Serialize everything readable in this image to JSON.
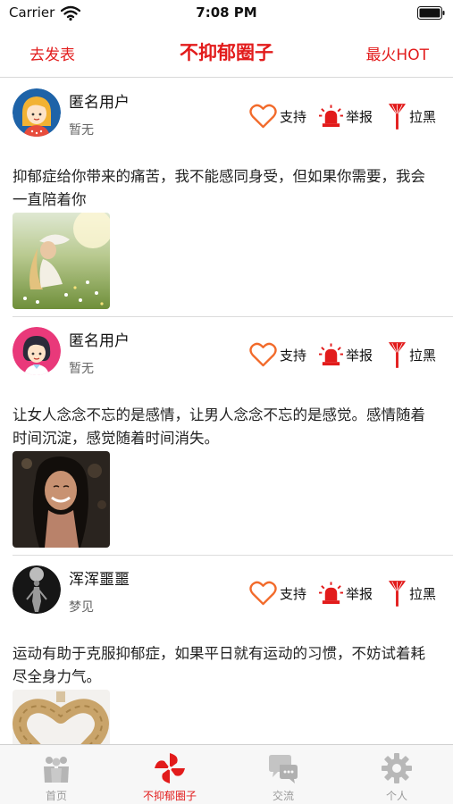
{
  "status_bar": {
    "carrier": "Carrier",
    "time": "7:08 PM"
  },
  "nav": {
    "left_label": "去发表",
    "title": "不抑郁圈子",
    "right_label": "最火HOT"
  },
  "posts": [
    {
      "username": "匿名用户",
      "subtitle": "暂无",
      "content": "抑郁症给你带来的痛苦，我不能感同身受，但如果你需要，我会一直陪着你",
      "avatar_icon": "blonde-girl-avatar-icon",
      "image": "girl-in-meadow-photo"
    },
    {
      "username": "匿名用户",
      "subtitle": "暂无",
      "content": "让女人念念不忘的是感情，让男人念念不忘的是感觉。感情随着时间沉淀，感觉随着时间消失。",
      "avatar_icon": "dark-haired-girl-avatar-icon",
      "image": "smiling-woman-photo"
    },
    {
      "username": "浑浑噩噩",
      "subtitle": "梦见",
      "content": "运动有助于克服抑郁症，如果平日就有运动的习惯，不妨试着耗尽全身力气。",
      "avatar_icon": "dark-figure-avatar-icon",
      "image": "wooden-heart-photo"
    }
  ],
  "actions": {
    "support": "支持",
    "report": "举报",
    "block": "拉黑"
  },
  "tabs": [
    {
      "label": "首页",
      "icon": "people-icon",
      "active": false
    },
    {
      "label": "不抑郁圈子",
      "icon": "pinwheel-icon",
      "active": true
    },
    {
      "label": "交流",
      "icon": "chat-icon",
      "active": false
    },
    {
      "label": "个人",
      "icon": "gear-icon",
      "active": false
    }
  ],
  "colors": {
    "accent": "#e21b1b",
    "heart": "#f26a2a",
    "tab_inactive": "#9a9a9a"
  }
}
